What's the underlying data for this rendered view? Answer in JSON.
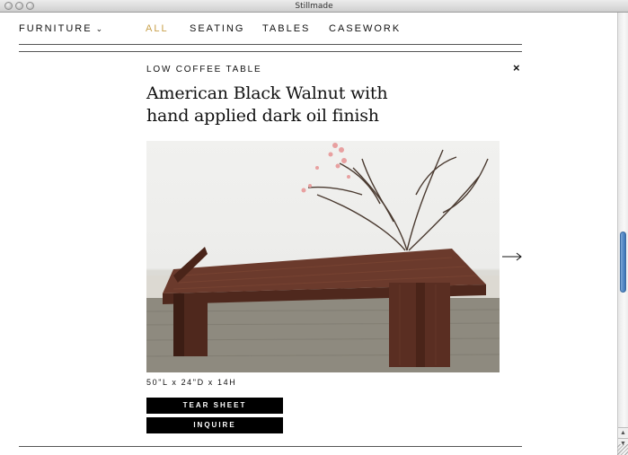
{
  "window": {
    "title": "Stillmade"
  },
  "nav": {
    "furniture": "FURNITURE",
    "items": [
      {
        "label": "ALL",
        "active": true
      },
      {
        "label": "SEATING",
        "active": false
      },
      {
        "label": "TABLES",
        "active": false
      },
      {
        "label": "CASEWORK",
        "active": false
      }
    ]
  },
  "product": {
    "category": "LOW COFFEE TABLE",
    "title_line1": "American Black Walnut with",
    "title_line2": "hand applied dark oil finish",
    "close": "×",
    "dimensions": "50\"L x 24\"D x 14H",
    "tear_sheet": "TEAR SHEET",
    "inquire": "INQUIRE",
    "image_icon": "walnut-table-photo",
    "next_icon": "arrow-right-icon"
  },
  "colors": {
    "accent": "#c8a04a",
    "walnut": "#5a2e22",
    "button": "#000000"
  }
}
